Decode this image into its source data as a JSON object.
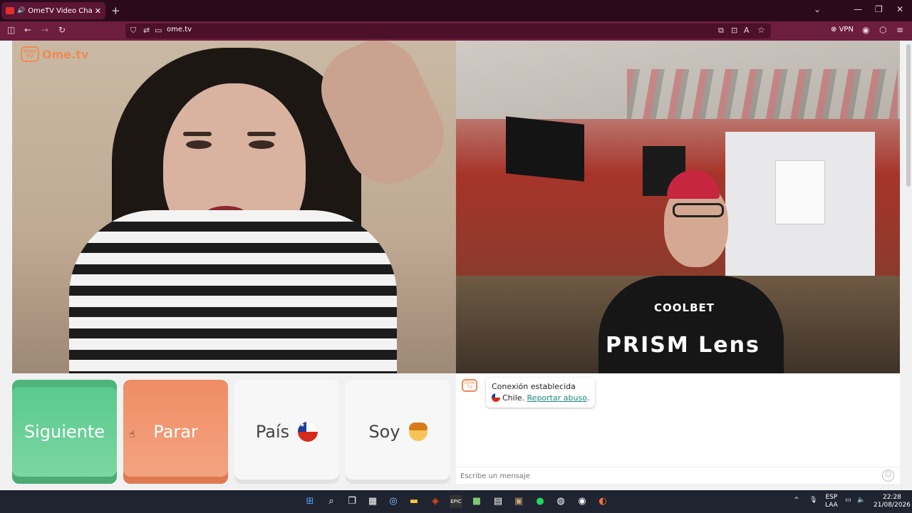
{
  "browser": {
    "tab_title": "OmeTV Video Chat — Ome",
    "tab_close": "✕",
    "new_tab": "+",
    "url": "ome.tv",
    "vpn_label": "VPN"
  },
  "window_controls": [
    "⌄",
    "—",
    "❐",
    "✕"
  ],
  "site": {
    "logo_badge": "Ome TV",
    "logo_text": "Ome.tv"
  },
  "remote_video": {
    "sponsor_text": "COOLBET",
    "watermark": "PRISM Lens"
  },
  "buttons": {
    "next": "Siguiente",
    "stop": "Parar",
    "country": "País",
    "self": "Soy"
  },
  "chat": {
    "status_title": "Conexión establecida",
    "country": "Chile.",
    "report_link": "Reportar abuso",
    "report_suffix": ".",
    "message_placeholder": "Escribe un mensaje"
  },
  "taskbar": {
    "lang_top": "ESP",
    "lang_bottom": "LAA",
    "time": "22:28",
    "date": "21/08/2026"
  },
  "colors": {
    "next_green": "#56c98b",
    "stop_orange": "#ef8d65",
    "brand_orange": "#f08a56",
    "link": "#1a8a7a"
  }
}
